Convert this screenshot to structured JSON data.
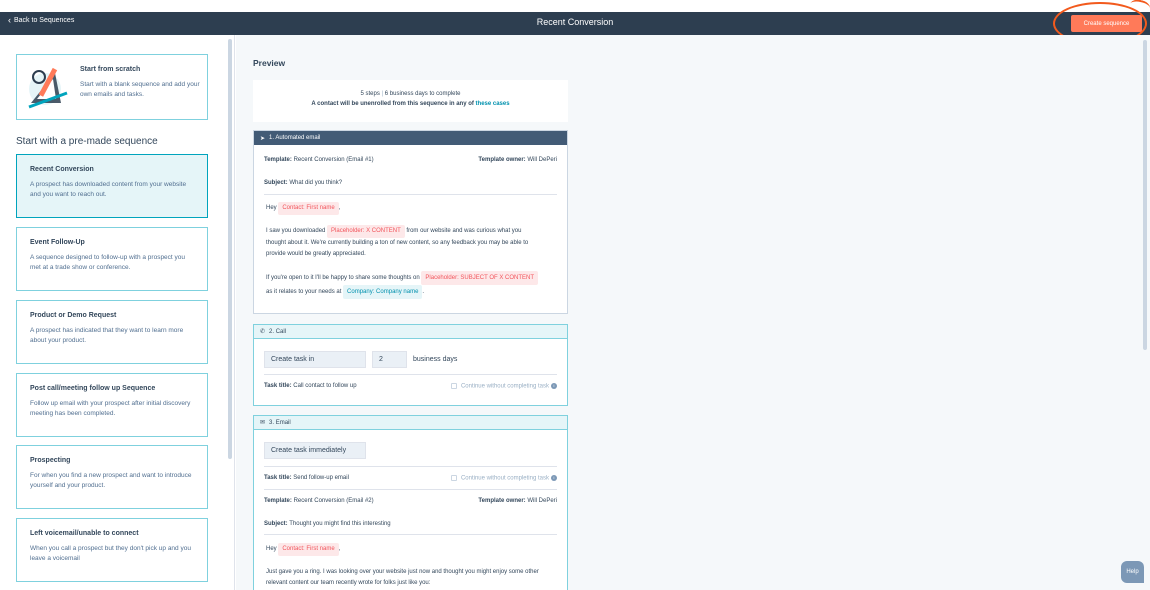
{
  "header": {
    "back_label": "Back to Sequences",
    "title": "Recent Conversion",
    "create_button": "Create sequence"
  },
  "sidebar": {
    "scratch": {
      "title": "Start from scratch",
      "description": "Start with a blank sequence and add your own emails and tasks."
    },
    "section_heading": "Start with a pre-made sequence",
    "templates": [
      {
        "title": "Recent Conversion",
        "description": "A prospect has downloaded content from your website and you want to reach out."
      },
      {
        "title": "Event Follow-Up",
        "description": "A sequence designed to follow-up with a prospect you met at a trade show or conference."
      },
      {
        "title": "Product or Demo Request",
        "description": "A prospect has indicated that they want to learn more about your product."
      },
      {
        "title": "Post call/meeting follow up Sequence",
        "description": "Follow up email with your prospect after initial discovery meeting has been completed."
      },
      {
        "title": "Prospecting",
        "description": "For when you find a new prospect and want to introduce yourself and your product."
      },
      {
        "title": "Left voicemail/unable to connect",
        "description": "When you call a prospect but they don't pick up and you leave a voicemail"
      }
    ]
  },
  "preview": {
    "label": "Preview",
    "summary": {
      "steps": "5 steps",
      "separator": "|",
      "days": "6 business days to complete",
      "unenroll_text": "A contact will be unenrolled from this sequence in any of",
      "unenroll_link": "these cases"
    },
    "step1": {
      "header": "1. Automated email",
      "template_label": "Template:",
      "template_value": "Recent Conversion (Email #1)",
      "owner_label": "Template owner:",
      "owner_value": "Will DePeri",
      "subject_label": "Subject:",
      "subject_value": "What did you think?",
      "hey": "Hey",
      "token_first_name": "Contact: First name",
      "comma": ",",
      "p1_a": "I saw you downloaded",
      "token_x_content": "Placeholder: X CONTENT",
      "p1_b": "from our website and was curious what you",
      "p1_c": "thought about it. We're currently building a ton of new content, so any feedback you may be able to",
      "p1_d": "provide would be greatly appreciated.",
      "p2_a": "If you're open to it I'll be happy to share some thoughts on",
      "token_subject": "Placeholder: SUBJECT OF X CONTENT",
      "p2_b": "as it relates to your needs at",
      "token_company": "Company: Company name",
      "period": "."
    },
    "step2": {
      "header": "2. Call",
      "create_task_label": "Create task in",
      "days_value": "2",
      "days_unit": "business days",
      "task_title_label": "Task title:",
      "task_title_value": "Call contact to follow up",
      "continue_label": "Continue without completing task"
    },
    "step3": {
      "header": "3. Email",
      "create_task_label": "Create task immediately",
      "task_title_label": "Task title:",
      "task_title_value": "Send follow-up email",
      "continue_label": "Continue without completing task",
      "template_label": "Template:",
      "template_value": "Recent Conversion (Email #2)",
      "owner_label": "Template owner:",
      "owner_value": "Will DePeri",
      "subject_label": "Subject:",
      "subject_value": "Thought you might find this interesting",
      "hey": "Hey",
      "token_first_name": "Contact: First name",
      "comma": ",",
      "p1_a": "Just gave you a ring. I was looking over your website just now and thought you might enjoy some other",
      "p1_b": "relevant content our team recently wrote for folks just like you:"
    }
  },
  "help_label": "Help",
  "colors": {
    "header_bg": "#2d3e50",
    "accent": "#ff7a59",
    "highlight_ring": "#f25a1d",
    "selected_bg": "#e5f5f8",
    "selected_border": "#00a4bd"
  }
}
